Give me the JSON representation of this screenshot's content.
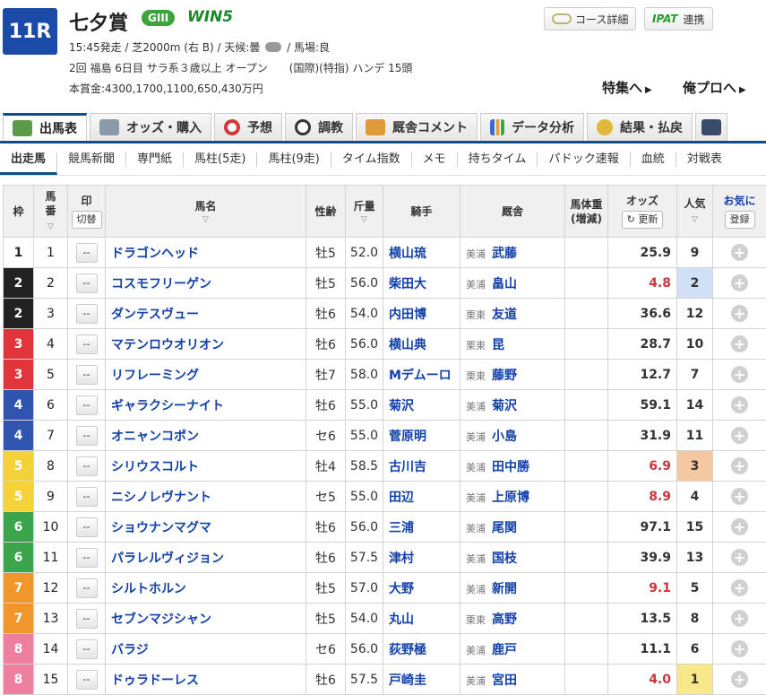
{
  "race": {
    "number": "11R",
    "title": "七夕賞",
    "grade": "GIII",
    "win5": "WIN5",
    "info1_a": "15:45発走 / 芝2000m (右 B) / 天候:曇",
    "info1_b": "/ 馬場:良",
    "info2": "2回 福島 6日目 サラ系３歳以上 オープン　　(国際)(特指) ハンデ 15頭",
    "info3": "本賞金:4300,1700,1100,650,430万円"
  },
  "header_buttons": {
    "course": "コース詳細",
    "ipat": "IPAT",
    "renkei": "連携"
  },
  "links": {
    "special": "特集へ",
    "pro": "俺プロへ"
  },
  "tabs": [
    "出馬表",
    "オッズ・購入",
    "予想",
    "調教",
    "厩舎コメント",
    "データ分析",
    "結果・払戻"
  ],
  "subtabs": [
    "出走馬",
    "競馬新聞",
    "専門紙",
    "馬柱(5走)",
    "馬柱(9走)",
    "タイム指数",
    "メモ",
    "持ちタイム",
    "パドック速報",
    "血統",
    "対戦表"
  ],
  "columns": {
    "waku": "枠",
    "umaban1": "馬",
    "umaban2": "番",
    "mark": "印",
    "mark_btn": "切替",
    "horse": "馬名",
    "sexage": "性齢",
    "kin": "斤量",
    "jockey": "騎手",
    "trainer": "厩舎",
    "weight1": "馬体重",
    "weight2": "(増減)",
    "odds": "オッズ",
    "odds_btn": "更新",
    "pop": "人気",
    "fav": "お気に",
    "fav_btn": "登録"
  },
  "waku_colors": {
    "1": {
      "bg": "#ffffff",
      "fg": "#222222"
    },
    "2": {
      "bg": "#222222",
      "fg": "#ffffff"
    },
    "3": {
      "bg": "#e0353a",
      "fg": "#ffffff"
    },
    "4": {
      "bg": "#2f55b0",
      "fg": "#ffffff"
    },
    "5": {
      "bg": "#f5d23a",
      "fg": "#ffffff"
    },
    "6": {
      "bg": "#3aa54a",
      "fg": "#ffffff"
    },
    "7": {
      "bg": "#f0962a",
      "fg": "#ffffff"
    },
    "8": {
      "bg": "#ef7f9e",
      "fg": "#ffffff"
    }
  },
  "horses": [
    {
      "waku": "1",
      "num": "1",
      "mark": "--",
      "name": "ドラゴンヘッド",
      "sexage": "牡5",
      "kin": "52.0",
      "jockey": "横山琉",
      "area": "美浦",
      "trainer": "武藤",
      "odds": "25.9",
      "hot": false,
      "pop": "9",
      "pop_bg": ""
    },
    {
      "waku": "2",
      "num": "2",
      "mark": "--",
      "name": "コスモフリーゲン",
      "sexage": "牡5",
      "kin": "56.0",
      "jockey": "柴田大",
      "area": "美浦",
      "trainer": "畠山",
      "odds": "4.8",
      "hot": true,
      "pop": "2",
      "pop_bg": "#cfe0f7"
    },
    {
      "waku": "2",
      "num": "3",
      "mark": "--",
      "name": "ダンテスヴュー",
      "sexage": "牡6",
      "kin": "54.0",
      "jockey": "内田博",
      "area": "栗東",
      "trainer": "友道",
      "odds": "36.6",
      "hot": false,
      "pop": "12",
      "pop_bg": ""
    },
    {
      "waku": "3",
      "num": "4",
      "mark": "--",
      "name": "マテンロウオリオン",
      "sexage": "牡6",
      "kin": "56.0",
      "jockey": "横山典",
      "area": "栗東",
      "trainer": "昆",
      "odds": "28.7",
      "hot": false,
      "pop": "10",
      "pop_bg": ""
    },
    {
      "waku": "3",
      "num": "5",
      "mark": "--",
      "name": "リフレーミング",
      "sexage": "牡7",
      "kin": "58.0",
      "jockey": "Mデムーロ",
      "area": "栗東",
      "trainer": "藤野",
      "odds": "12.7",
      "hot": false,
      "pop": "7",
      "pop_bg": ""
    },
    {
      "waku": "4",
      "num": "6",
      "mark": "--",
      "name": "ギャラクシーナイト",
      "sexage": "牡6",
      "kin": "55.0",
      "jockey": "菊沢",
      "area": "美浦",
      "trainer": "菊沢",
      "odds": "59.1",
      "hot": false,
      "pop": "14",
      "pop_bg": ""
    },
    {
      "waku": "4",
      "num": "7",
      "mark": "--",
      "name": "オニャンコポン",
      "sexage": "セ6",
      "kin": "55.0",
      "jockey": "菅原明",
      "area": "美浦",
      "trainer": "小島",
      "odds": "31.9",
      "hot": false,
      "pop": "11",
      "pop_bg": ""
    },
    {
      "waku": "5",
      "num": "8",
      "mark": "--",
      "name": "シリウスコルト",
      "sexage": "牡4",
      "kin": "58.5",
      "jockey": "古川吉",
      "area": "美浦",
      "trainer": "田中勝",
      "odds": "6.9",
      "hot": true,
      "pop": "3",
      "pop_bg": "#f4c9a2"
    },
    {
      "waku": "5",
      "num": "9",
      "mark": "--",
      "name": "ニシノレヴナント",
      "sexage": "セ5",
      "kin": "55.0",
      "jockey": "田辺",
      "area": "美浦",
      "trainer": "上原博",
      "odds": "8.9",
      "hot": true,
      "pop": "4",
      "pop_bg": ""
    },
    {
      "waku": "6",
      "num": "10",
      "mark": "--",
      "name": "ショウナンマグマ",
      "sexage": "牡6",
      "kin": "56.0",
      "jockey": "三浦",
      "area": "美浦",
      "trainer": "尾関",
      "odds": "97.1",
      "hot": false,
      "pop": "15",
      "pop_bg": ""
    },
    {
      "waku": "6",
      "num": "11",
      "mark": "--",
      "name": "パラレルヴィジョン",
      "sexage": "牡6",
      "kin": "57.5",
      "jockey": "津村",
      "area": "美浦",
      "trainer": "国枝",
      "odds": "39.9",
      "hot": false,
      "pop": "13",
      "pop_bg": ""
    },
    {
      "waku": "7",
      "num": "12",
      "mark": "--",
      "name": "シルトホルン",
      "sexage": "牡5",
      "kin": "57.0",
      "jockey": "大野",
      "area": "美浦",
      "trainer": "新開",
      "odds": "9.1",
      "hot": true,
      "pop": "5",
      "pop_bg": ""
    },
    {
      "waku": "7",
      "num": "13",
      "mark": "--",
      "name": "セブンマジシャン",
      "sexage": "牡5",
      "kin": "54.0",
      "jockey": "丸山",
      "area": "栗東",
      "trainer": "高野",
      "odds": "13.5",
      "hot": false,
      "pop": "8",
      "pop_bg": ""
    },
    {
      "waku": "8",
      "num": "14",
      "mark": "--",
      "name": "バラジ",
      "sexage": "セ6",
      "kin": "56.0",
      "jockey": "荻野極",
      "area": "美浦",
      "trainer": "鹿戸",
      "odds": "11.1",
      "hot": false,
      "pop": "6",
      "pop_bg": ""
    },
    {
      "waku": "8",
      "num": "15",
      "mark": "--",
      "name": "ドゥラドーレス",
      "sexage": "牡6",
      "kin": "57.5",
      "jockey": "戸崎圭",
      "area": "美浦",
      "trainer": "宮田",
      "odds": "4.0",
      "hot": true,
      "pop": "1",
      "pop_bg": "#f7e98a"
    }
  ]
}
